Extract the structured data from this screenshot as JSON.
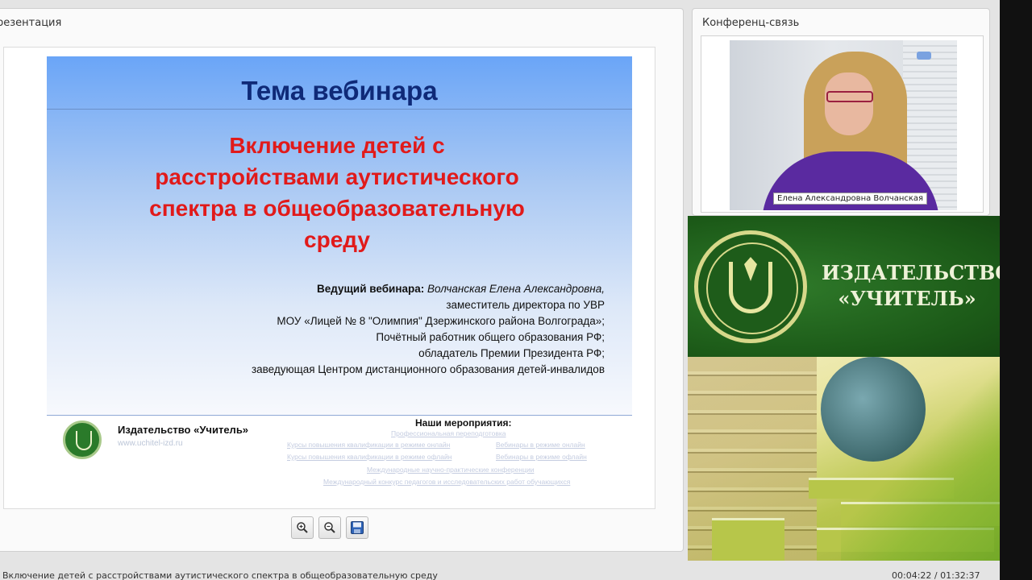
{
  "presentation": {
    "panel_title": "резентация",
    "slide": {
      "heading": "Тема вебинара",
      "topic_lines": [
        "Включение детей с",
        "расстройствами аутистического",
        "спектра в общеобразовательную",
        "среду"
      ],
      "presenter": {
        "label": "Ведущий вебинара:",
        "name": "Волчанская Елена Александровна,",
        "lines": [
          "заместитель директора по УВР",
          "МОУ «Лицей № 8 \"Олимпия\" Дзержинского района Волгограда»;",
          "Почётный работник общего образования РФ;",
          "обладатель Премии Президента РФ;",
          "заведующая Центром дистанционного образования детей-инвалидов"
        ]
      },
      "footer": {
        "publisher": "Издательство «Учитель»",
        "site": "www.uchitel-izd.ru",
        "events_title": "Наши мероприятия:",
        "links": [
          "Профессиональная переподготовка",
          "Курсы повышения квалификации в режиме онлайн",
          "Вебинары в режиме онлайн",
          "Курсы повышения квалификации в режиме офлайн",
          "Вебинары в режиме офлайн",
          "Международные научно-практические конференции",
          "Международный конкурс педагогов и исследовательских работ обучающихся"
        ]
      }
    },
    "tools": {
      "zoom_in": "zoom-in-icon",
      "zoom_out": "zoom-out-icon",
      "save": "save-icon"
    }
  },
  "status": {
    "title": "Включение детей с расстройствами аутистического спектра в общеобразовательную среду",
    "time": "00:04:22 / 01:32:37"
  },
  "conference": {
    "panel_title": "Конференц-связь",
    "caption": "Елена Александровна Волчанская"
  },
  "brand": {
    "line1": "ИЗДАТЕЛЬСТВО",
    "line2": "«УЧИТЕЛЬ»"
  },
  "colors": {
    "slide_heading": "#0f2a78",
    "slide_topic": "#e11a1a",
    "brand_green": "#1c5a18",
    "brand_text": "#eef2d8"
  }
}
